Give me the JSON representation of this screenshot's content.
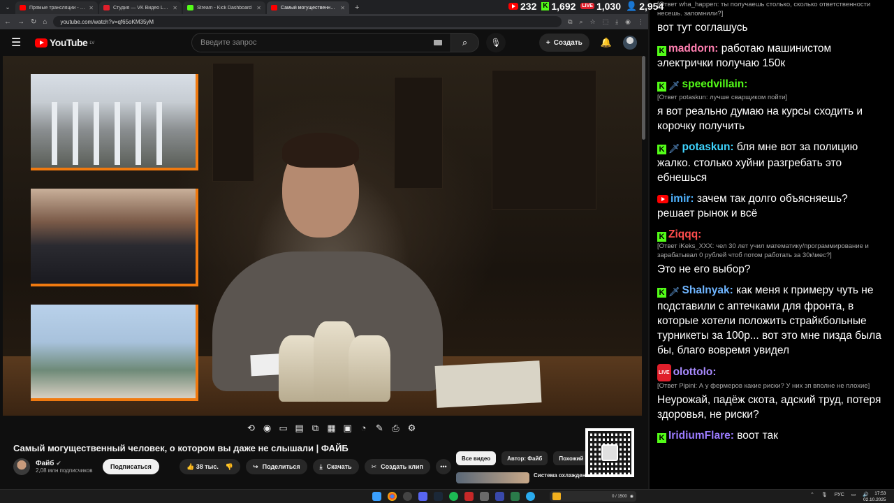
{
  "browser": {
    "tabs": [
      {
        "title": "Прямые трансляции - YouTube",
        "favicon_color": "#ff0000"
      },
      {
        "title": "Студия — VK Видео Live",
        "favicon_color": "#e01f2b"
      },
      {
        "title": "Stream - Kick Dashboard",
        "favicon_color": "#53fc18"
      },
      {
        "title": "Самый могущественный че…",
        "favicon_color": "#ff0000"
      }
    ],
    "url": "youtube.com/watch?v=qf65oKM35yM"
  },
  "stream_stats": {
    "youtube_viewers": "232",
    "kick_viewers": "1,692",
    "vk_viewers": "1,030",
    "total_viewers": "2,954"
  },
  "youtube": {
    "logo_text": "YouTube",
    "country": "LV",
    "search_placeholder": "Введите запрос",
    "create_label": "Создать",
    "video_title": "Самый могущественный человек, о котором вы даже не слышали | ФАЙБ",
    "channel_name": "Файб",
    "subscribers": "2,08 млн подписчиков",
    "subscribe_label": "Подписаться",
    "likes": "38 тыс.",
    "share_label": "Поделиться",
    "download_label": "Скачать",
    "clip_label": "Создать клип",
    "chips": [
      "Все видео",
      "Автор: Файб",
      "Похожий к"
    ],
    "related_title": "Система охлаждения"
  },
  "chat": {
    "messages": [
      {
        "user": "",
        "color": "#ffffff",
        "badges": [],
        "reply": "[Ответ wha_happen: ты получаешь столько, сколько ответственности несешь. запомнили?]",
        "text": "вот тут соглашусь"
      },
      {
        "user": "maddorn:",
        "color": "#ff7fb0",
        "badges": [
          "kick"
        ],
        "reply": "",
        "text": "работаю машинистом электрички получаю 150к"
      },
      {
        "user": "speedvillain:",
        "color": "#53fc18",
        "badges": [
          "kick",
          "sword"
        ],
        "reply": "[Ответ potaskun: лучше сварщиком пойти]",
        "text": "я вот реально думаю на курсы сходить и корочку получить"
      },
      {
        "user": "potaskun:",
        "color": "#3fd5ff",
        "badges": [
          "kick",
          "sword"
        ],
        "reply": "",
        "text": "бля мне вот за полицию жалко. столько хуйни разгребать это ебнешься"
      },
      {
        "user": "imir:",
        "color": "#4fb3ff",
        "badges": [
          "youtube"
        ],
        "reply": "",
        "text": "зачем так долго объясняешь? решает рынок и всё"
      },
      {
        "user": "Ziqqq:",
        "color": "#ff4d4d",
        "badges": [
          "kick"
        ],
        "reply": "[Ответ iKeks_XXX: чел 30 лет учил математику/программирование и зарабатывал 0 рублей чтоб потом работать за 30к\\мес?]",
        "text": "Это не его выбор?"
      },
      {
        "user": "Shalnyak:",
        "color": "#6fb5ff",
        "badges": [
          "kick",
          "sword"
        ],
        "reply": "",
        "text": "как меня к примеру чуть не подставили с аптечками для фронта, в которые хотели положить страйкбольные турникеты за 100р... вот это мне пизда была бы, благо вовремя увидел"
      },
      {
        "user": "olottolo:",
        "color": "#a98bff",
        "badges": [
          "vk"
        ],
        "reply": "[Ответ Pipini: А у фермеров какие риски? У них зп вполне не плохие]",
        "text": "Неурожай, падёж скота, адский труд, потеря здоровья, не риски?"
      },
      {
        "user": "IridiumFlare:",
        "color": "#9b7bff",
        "badges": [
          "kick"
        ],
        "reply": "",
        "text": "воот так"
      }
    ]
  },
  "taskbar": {
    "media_text": "0 / 1500",
    "lang": "РУС",
    "time": "17:53",
    "date": "02.10.2025"
  }
}
